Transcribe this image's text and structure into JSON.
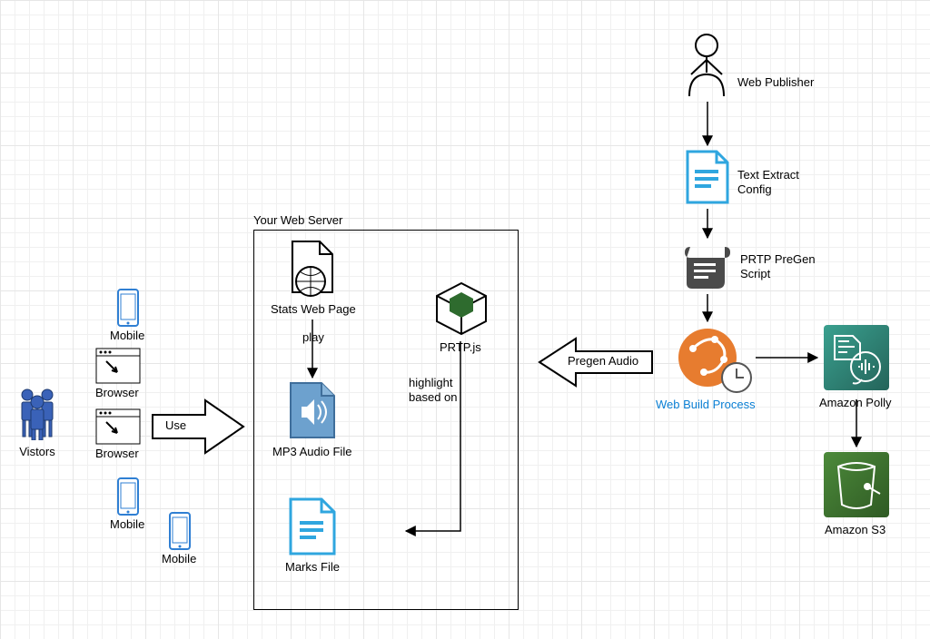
{
  "labels": {
    "visitors": "Vistors",
    "browser": "Browser",
    "mobile": "Mobile",
    "use": "Use",
    "server_title": "Your Web Server",
    "stats_page": "Stats Web Page",
    "play": "play",
    "mp3": "MP3 Audio File",
    "marks": "Marks File",
    "prtpjs": "PRTP.js",
    "highlight": "highlight\nbased on",
    "pregen": "Pregen Audio",
    "web_publisher": "Web Publisher",
    "text_extract": "Text Extract\nConfig",
    "prtp_script": "PRTP PreGen\nScript",
    "web_build": "Web Build Process",
    "polly": "Amazon Polly",
    "s3": "Amazon S3"
  }
}
